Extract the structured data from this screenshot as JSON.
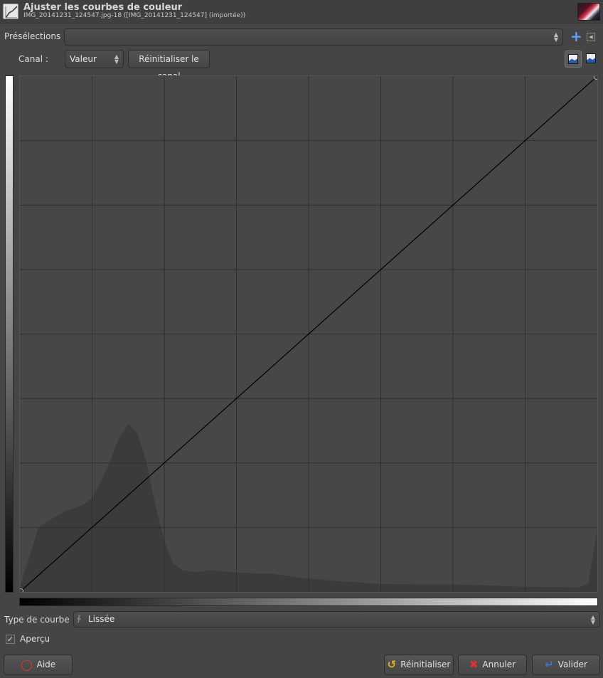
{
  "header": {
    "title": "Ajuster les courbes de couleur",
    "subtitle": "IMG_20141231_124547.jpg-18 ([IMG_20141231_124547] (importée))",
    "tool_icon": "curves-tool-icon",
    "thumbnail": "image-thumbnail"
  },
  "presets": {
    "label": "Présélections :",
    "value": "",
    "add_icon": "plus-icon",
    "menu_icon": "preset-menu-icon"
  },
  "channel": {
    "label": "Canal :",
    "value": "Valeur",
    "reset_label": "Réinitialiser le canal",
    "linear_histogram_icon": "linear-histogram-icon",
    "log_histogram_icon": "logarithmic-histogram-icon"
  },
  "curve": {
    "control_points": [
      [
        0,
        0
      ],
      [
        255,
        255
      ]
    ],
    "histogram": [
      0.03,
      0.2,
      0.38,
      0.42,
      0.45,
      0.48,
      0.5,
      0.52,
      0.56,
      0.66,
      0.78,
      0.92,
      1.0,
      0.95,
      0.78,
      0.52,
      0.3,
      0.17,
      0.13,
      0.12,
      0.12,
      0.13,
      0.125,
      0.12,
      0.115,
      0.115,
      0.11,
      0.11,
      0.11,
      0.1,
      0.095,
      0.085,
      0.08,
      0.075,
      0.07,
      0.065,
      0.06,
      0.06,
      0.055,
      0.05,
      0.048,
      0.048,
      0.046,
      0.046,
      0.045,
      0.045,
      0.044,
      0.044,
      0.044,
      0.043,
      0.043,
      0.04,
      0.038,
      0.036,
      0.034,
      0.032,
      0.03,
      0.03,
      0.029,
      0.029,
      0.029,
      0.028,
      0.028,
      0.05,
      0.38
    ]
  },
  "curve_type": {
    "label": "Type de courbe :",
    "value": "Lissée",
    "icon": "smooth-curve-icon"
  },
  "preview": {
    "label": "Aperçu",
    "checked": true
  },
  "buttons": {
    "help": "Aide",
    "reset": "Réinitialiser",
    "cancel": "Annuler",
    "ok": "Valider"
  },
  "colors": {
    "background": "#454545",
    "accent": "#5aa0ff",
    "cancel_icon": "#e03030",
    "help_icon": "#e03a3a",
    "ok_icon": "#3a78d8",
    "reset_icon": "#e0b020"
  }
}
